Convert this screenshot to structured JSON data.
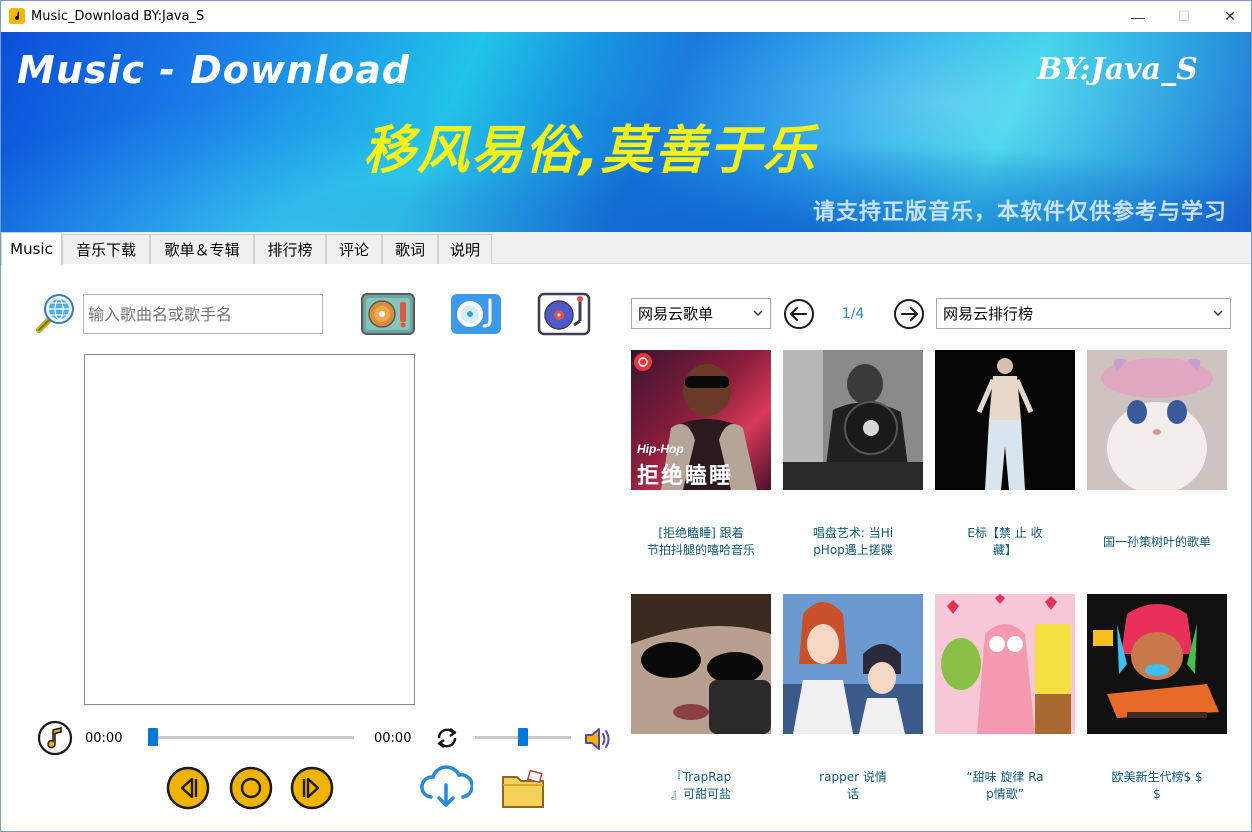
{
  "window": {
    "title": "Music_Download    BY:Java_S",
    "minimize_glyph": "—",
    "maximize_glyph": "☐",
    "close_glyph": "✕"
  },
  "banner": {
    "title": "Music - Download",
    "author": "BY:Java_S",
    "slogan": "移风易俗,莫善于乐",
    "notice": "请支持正版音乐，本软件仅供参考与学习"
  },
  "tabs": [
    {
      "label": "Music",
      "active": true
    },
    {
      "label": "音乐下载",
      "active": false
    },
    {
      "label": "歌单＆专辑",
      "active": false
    },
    {
      "label": "排行榜",
      "active": false
    },
    {
      "label": "评论",
      "active": false
    },
    {
      "label": "歌词",
      "active": false
    },
    {
      "label": "说明",
      "active": false
    }
  ],
  "search": {
    "placeholder": "输入歌曲名或歌手名",
    "value": ""
  },
  "player": {
    "current_time": "00:00",
    "total_time": "00:00",
    "progress": 0.0,
    "volume": 0.5
  },
  "right": {
    "playlist_select": "网易云歌单",
    "page": "1/4",
    "chart_select": "网易云排行榜",
    "covers": [
      {
        "caption_lines": [
          "[拒绝瞌睡] 跟着",
          "节拍抖腿的嘻哈音乐"
        ],
        "overlay_top": "Hip-Hop",
        "overlay_main": "拒绝瞌睡"
      },
      {
        "caption_lines": [
          "唱盘艺术: 当Hi",
          "pHop遇上搓碟"
        ]
      },
      {
        "caption_lines": [
          "E标【禁 止 收",
          "藏】"
        ]
      },
      {
        "caption_lines": [
          "国一孙策树叶的歌单"
        ]
      },
      {
        "caption_lines": [
          "『TrapRap",
          "』可甜可盐"
        ]
      },
      {
        "caption_lines": [
          "rapper 说情",
          "话"
        ]
      },
      {
        "caption_lines": [
          "“甜味 旋律 Ra",
          "p情歌”"
        ]
      },
      {
        "caption_lines": [
          "欧美新生代榜$ $",
          "$"
        ]
      }
    ]
  },
  "colors": {
    "accent": "#0078d7",
    "page_indicator": "#1e8cd8",
    "slogan": "#f4f11a",
    "caption": "#0e5a7a"
  }
}
